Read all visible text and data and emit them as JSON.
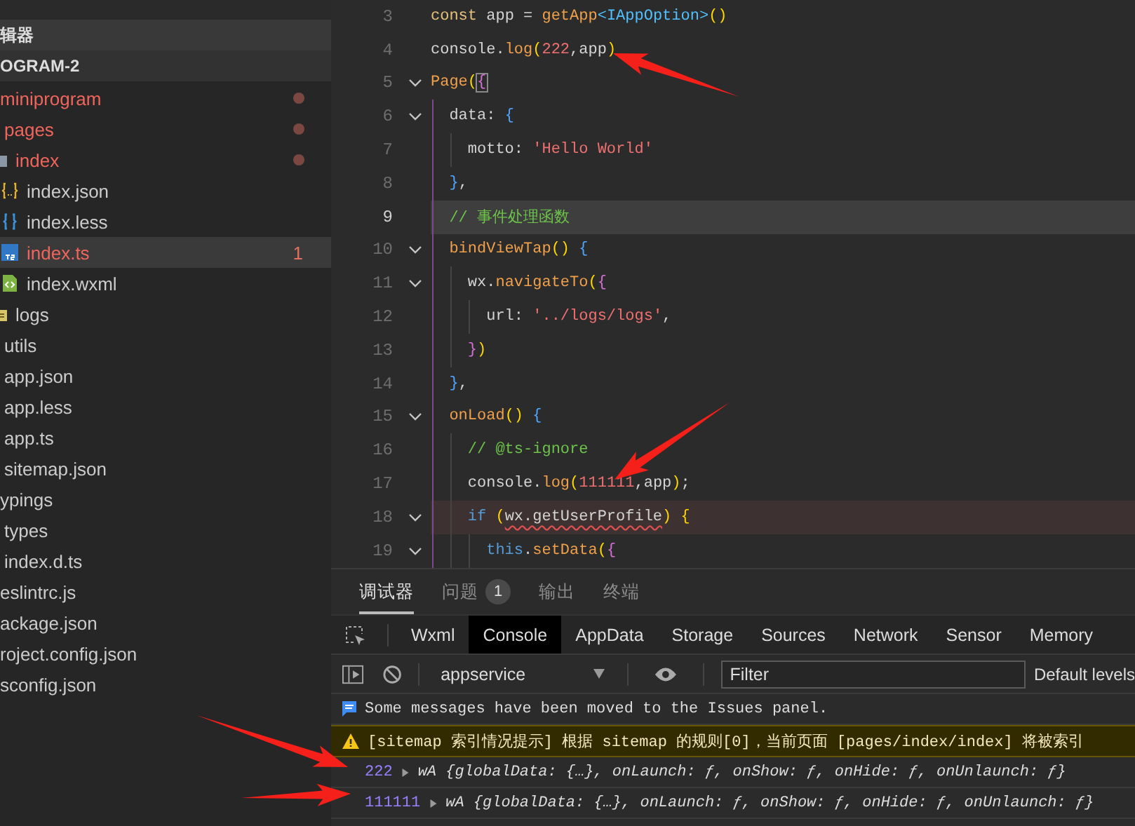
{
  "sidebar": {
    "section_title": "辑器",
    "project_title": "OGRAM-2",
    "tree": [
      {
        "name": "miniprogram",
        "modified": true,
        "dot": true,
        "selected": false,
        "children": [
          {
            "name": "pages",
            "modified": true,
            "dot": true,
            "selected": false,
            "children": [
              {
                "name": "index",
                "kind": "folder",
                "modified": true,
                "dot": true,
                "selected": false,
                "children": [
                  {
                    "name": "index.json",
                    "kind": "json",
                    "modified": false,
                    "dot": false,
                    "selected": false
                  },
                  {
                    "name": "index.less",
                    "kind": "less",
                    "modified": false,
                    "dot": false,
                    "selected": false
                  },
                  {
                    "name": "index.ts",
                    "kind": "ts",
                    "modified": true,
                    "dot": false,
                    "selected": true,
                    "problems": "1"
                  },
                  {
                    "name": "index.wxml",
                    "kind": "wxml",
                    "modified": false,
                    "dot": false,
                    "selected": false
                  }
                ]
              },
              {
                "name": "logs",
                "kind": "logfolder",
                "modified": false,
                "dot": false,
                "selected": false
              }
            ]
          },
          {
            "name": "utils",
            "modified": false,
            "dot": false,
            "selected": false
          },
          {
            "name": "app.json",
            "modified": false,
            "dot": false,
            "selected": false
          },
          {
            "name": "app.less",
            "modified": false,
            "dot": false,
            "selected": false
          },
          {
            "name": "app.ts",
            "modified": false,
            "dot": false,
            "selected": false
          },
          {
            "name": "sitemap.json",
            "modified": false,
            "dot": false,
            "selected": false
          }
        ]
      },
      {
        "name": "ypings",
        "modified": false,
        "dot": false,
        "selected": false,
        "children": [
          {
            "name": "types",
            "modified": false,
            "dot": false,
            "selected": false
          },
          {
            "name": "index.d.ts",
            "modified": false,
            "dot": false,
            "selected": false
          }
        ]
      },
      {
        "name": "eslintrc.js",
        "modified": false,
        "dot": false,
        "selected": false
      },
      {
        "name": "ackage.json",
        "modified": false,
        "dot": false,
        "selected": false
      },
      {
        "name": "roject.config.json",
        "modified": false,
        "dot": false,
        "selected": false
      },
      {
        "name": "sconfig.json",
        "modified": false,
        "dot": false,
        "selected": false
      }
    ]
  },
  "editor": {
    "lines": [
      {
        "number": "3",
        "fold": false,
        "tokens": [
          {
            "kind": "keyword",
            "text": "const"
          },
          {
            "kind": "plain",
            "text": " app = "
          },
          {
            "kind": "function",
            "text": "getApp"
          },
          {
            "kind": "type",
            "text": "<IAppOption>"
          },
          {
            "kind": "paren",
            "text": "()"
          }
        ]
      },
      {
        "number": "4",
        "fold": false,
        "tokens": [
          {
            "kind": "plain",
            "text": "console."
          },
          {
            "kind": "function",
            "text": "log"
          },
          {
            "kind": "paren",
            "text": "("
          },
          {
            "kind": "number",
            "text": "222"
          },
          {
            "kind": "plain",
            "text": ",app"
          },
          {
            "kind": "paren",
            "text": ")"
          }
        ]
      },
      {
        "number": "5",
        "fold": true,
        "tokens": [
          {
            "kind": "function",
            "text": "Page"
          },
          {
            "kind": "paren",
            "text": "("
          },
          {
            "kind": "brace2",
            "text": "{",
            "matched": true
          }
        ]
      },
      {
        "number": "6",
        "fold": true,
        "tokens": [
          {
            "kind": "plain",
            "text": "  data: "
          },
          {
            "kind": "brace",
            "text": "{"
          }
        ]
      },
      {
        "number": "7",
        "fold": false,
        "tokens": [
          {
            "kind": "plain",
            "text": "    motto: "
          },
          {
            "kind": "string",
            "text": "'Hello World'"
          }
        ]
      },
      {
        "number": "8",
        "fold": false,
        "tokens": [
          {
            "kind": "brace",
            "text": "  }"
          },
          {
            "kind": "plain",
            "text": ","
          }
        ]
      },
      {
        "number": "9",
        "fold": false,
        "current": true,
        "tokens": [
          {
            "kind": "comment",
            "text": "  // 事件处理函数"
          }
        ]
      },
      {
        "number": "10",
        "fold": true,
        "tokens": [
          {
            "kind": "function",
            "text": "  bindViewTap"
          },
          {
            "kind": "paren",
            "text": "()"
          },
          {
            "kind": "brace",
            "text": " {"
          }
        ]
      },
      {
        "number": "11",
        "fold": true,
        "tokens": [
          {
            "kind": "plain",
            "text": "    wx."
          },
          {
            "kind": "function",
            "text": "navigateTo"
          },
          {
            "kind": "paren",
            "text": "("
          },
          {
            "kind": "brace2",
            "text": "{"
          }
        ]
      },
      {
        "number": "12",
        "fold": false,
        "tokens": [
          {
            "kind": "plain",
            "text": "      url: "
          },
          {
            "kind": "string",
            "text": "'../logs/logs'"
          },
          {
            "kind": "plain",
            "text": ","
          }
        ]
      },
      {
        "number": "13",
        "fold": false,
        "tokens": [
          {
            "kind": "brace2",
            "text": "    }"
          },
          {
            "kind": "paren",
            "text": ")"
          }
        ]
      },
      {
        "number": "14",
        "fold": false,
        "tokens": [
          {
            "kind": "brace",
            "text": "  }"
          },
          {
            "kind": "plain",
            "text": ","
          }
        ]
      },
      {
        "number": "15",
        "fold": true,
        "tokens": [
          {
            "kind": "function",
            "text": "  onLoad"
          },
          {
            "kind": "paren",
            "text": "()"
          },
          {
            "kind": "brace",
            "text": " {"
          }
        ]
      },
      {
        "number": "16",
        "fold": false,
        "tokens": [
          {
            "kind": "comment",
            "text": "    // @ts-ignore"
          }
        ]
      },
      {
        "number": "17",
        "fold": false,
        "tokens": [
          {
            "kind": "plain",
            "text": "    console."
          },
          {
            "kind": "function",
            "text": "log"
          },
          {
            "kind": "paren",
            "text": "("
          },
          {
            "kind": "number",
            "text": "111111"
          },
          {
            "kind": "plain",
            "text": ",app"
          },
          {
            "kind": "paren",
            "text": ")"
          },
          {
            "kind": "plain",
            "text": ";"
          }
        ]
      },
      {
        "number": "18",
        "fold": true,
        "problem": true,
        "tokens": [
          {
            "kind": "keyword2",
            "text": "    if"
          },
          {
            "kind": "paren",
            "text": " ("
          },
          {
            "kind": "plain",
            "text": "wx.getUserProfile",
            "squiggle": true
          },
          {
            "kind": "paren",
            "text": ") {"
          }
        ]
      },
      {
        "number": "19",
        "fold": true,
        "tokens": [
          {
            "kind": "keyword2",
            "text": "      this"
          },
          {
            "kind": "plain",
            "text": "."
          },
          {
            "kind": "function",
            "text": "setData"
          },
          {
            "kind": "paren",
            "text": "("
          },
          {
            "kind": "brace2",
            "text": "{"
          }
        ]
      }
    ]
  },
  "panel": {
    "tabs": [
      {
        "label": "调试器",
        "selected": true
      },
      {
        "label": "问题",
        "selected": false,
        "badge": "1"
      },
      {
        "label": "输出",
        "selected": false
      },
      {
        "label": "终端",
        "selected": false
      }
    ],
    "devtools_tabs": [
      {
        "label": "Wxml",
        "selected": false
      },
      {
        "label": "Console",
        "selected": true
      },
      {
        "label": "AppData",
        "selected": false
      },
      {
        "label": "Storage",
        "selected": false
      },
      {
        "label": "Sources",
        "selected": false
      },
      {
        "label": "Network",
        "selected": false
      },
      {
        "label": "Sensor",
        "selected": false
      },
      {
        "label": "Memory",
        "selected": false
      }
    ],
    "context": "appservice",
    "filter": {
      "placeholder": "Filter"
    },
    "levels": "Default levels",
    "console": [
      {
        "kind": "info",
        "text": "Some messages have been moved to the Issues panel."
      },
      {
        "kind": "warning",
        "text": "[sitemap 索引情况提示] 根据 sitemap 的规则[0]，当前页面 [pages/index/index] 将被索引"
      },
      {
        "kind": "log",
        "value": "222",
        "summary": "wA {globalData: {…}, onLaunch: ƒ, onShow: ƒ, onHide: ƒ, onUnlaunch: ƒ}",
        "expanded": false
      },
      {
        "kind": "log",
        "value": "111111",
        "summary": "wA {globalData: {…}, onLaunch: ƒ, onShow: ƒ, onHide: ƒ, onUnlaunch: ƒ}",
        "expanded": false
      }
    ]
  }
}
